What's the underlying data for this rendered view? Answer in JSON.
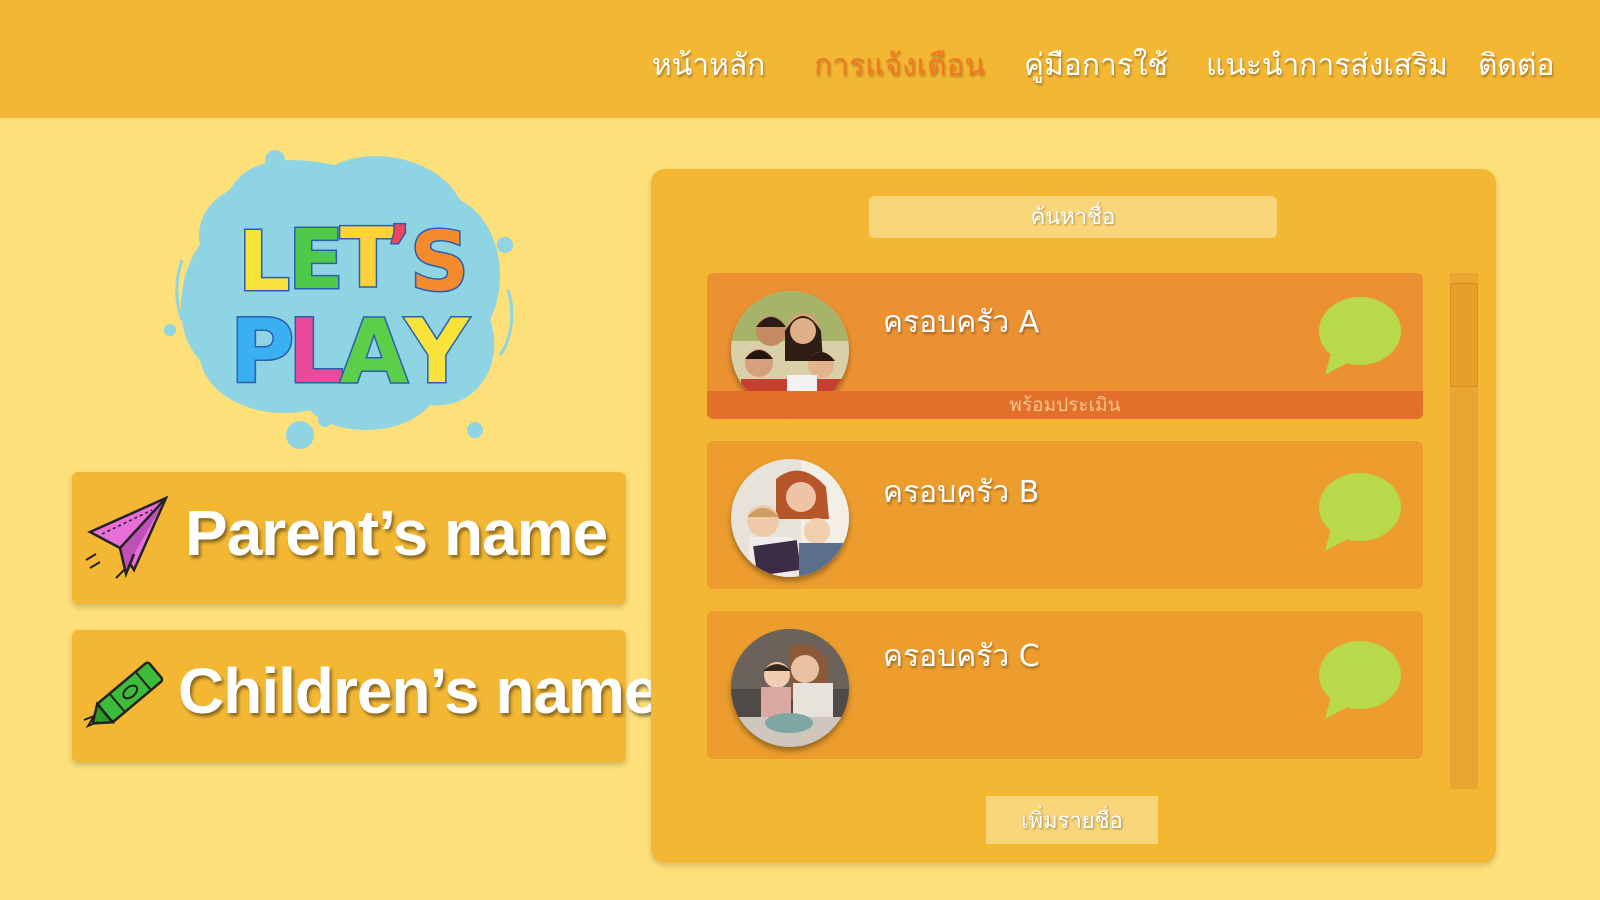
{
  "nav": {
    "items": [
      {
        "label": "หน้าหลัก",
        "active": false
      },
      {
        "label": "การแจ้งเตือน",
        "active": true
      },
      {
        "label": "คู่มือการใช้",
        "active": false
      },
      {
        "label": "แนะนำการส่งเสริม",
        "active": false
      },
      {
        "label": "ติดต่อ",
        "active": false
      }
    ]
  },
  "logo": {
    "line1": "LET'S",
    "line2": "PLAY"
  },
  "profile": {
    "parent_label": "Parent’s name",
    "children_label": "Children’s name",
    "parent_icon": "paper-plane-icon",
    "children_icon": "crayon-icon"
  },
  "panel": {
    "search_placeholder": "ค้นหาชื่อ",
    "families": [
      {
        "name": "ครอบครัว A",
        "status": "พร้อมประเมิน",
        "avatar": "family-photo-a"
      },
      {
        "name": "ครอบครัว B",
        "status": "",
        "avatar": "family-photo-b"
      },
      {
        "name": "ครอบครัว C",
        "status": "",
        "avatar": "family-photo-c"
      }
    ],
    "add_button": "เพิ่มรายชื่อ"
  },
  "colors": {
    "background": "#fde07a",
    "header": "#f3b733",
    "active_nav": "#f27a1e",
    "chat_bubble": "#b8d94a",
    "status_bar": "#e3702a"
  }
}
